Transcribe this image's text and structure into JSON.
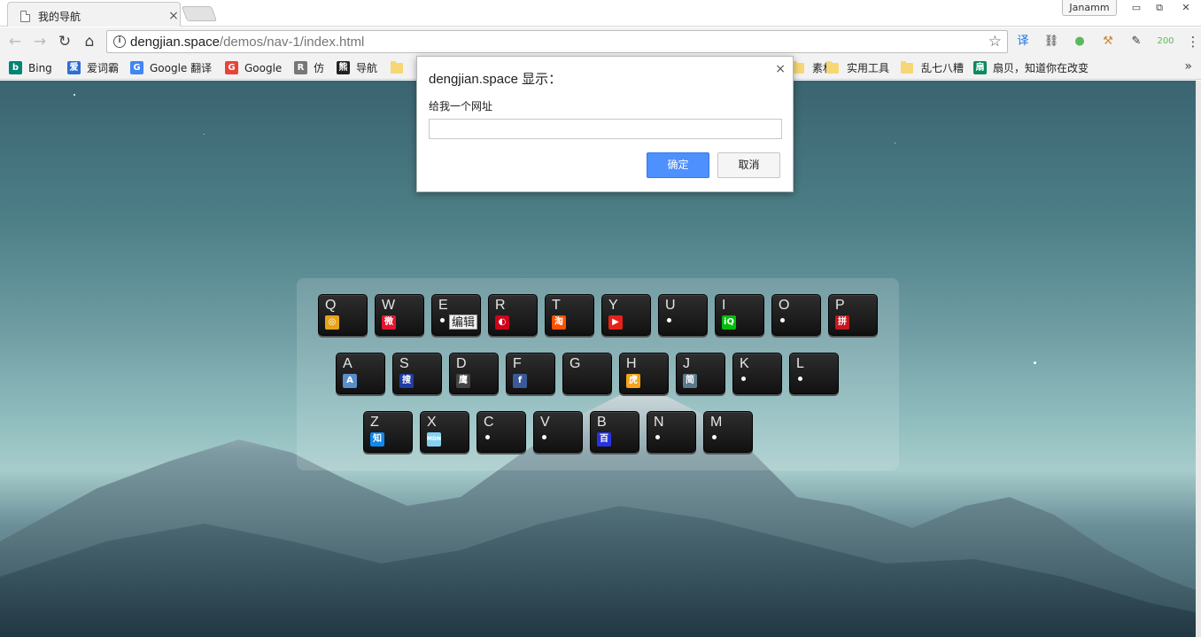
{
  "tab": {
    "title": "我的导航",
    "close": "×"
  },
  "profile": {
    "name": "Janamm"
  },
  "window": {
    "minimize": "▭",
    "restore": "⧉",
    "close": "✕"
  },
  "nav": {
    "back": "←",
    "forward": "→",
    "reload": "↻",
    "home": "⌂"
  },
  "omnibox": {
    "host": "dengjian.space",
    "path": "/demos/nav-1/index.html",
    "info": "i",
    "star": "☆"
  },
  "extensions": [
    {
      "name": "translate-icon",
      "glyph": "译",
      "color": "#1a73e8"
    },
    {
      "name": "link-extension-icon",
      "glyph": "⛓",
      "color": "#333"
    },
    {
      "name": "green-dot-icon",
      "glyph": "●",
      "color": "#5cb85c"
    },
    {
      "name": "hammer-icon",
      "glyph": "⚒",
      "color": "#c98a3c"
    },
    {
      "name": "pen-icon",
      "glyph": "✎",
      "color": "#333"
    }
  ],
  "extension_badge": "200",
  "menu_icon": "⋮",
  "bookmarks": [
    {
      "label": "Bing",
      "icon": "b",
      "color": "#008373",
      "type": "site"
    },
    {
      "label": "爱词霸",
      "icon": "爱",
      "color": "#2e6fd1",
      "type": "site"
    },
    {
      "label": "Google 翻译",
      "icon": "G",
      "color": "#4285f4",
      "type": "site"
    },
    {
      "label": "Google",
      "icon": "G",
      "color": "#ea4335",
      "type": "site"
    },
    {
      "label": "仿",
      "icon": "R",
      "color": "#777",
      "type": "site"
    },
    {
      "label": "导航",
      "icon": "熊",
      "color": "#222",
      "type": "site"
    },
    {
      "label": "",
      "type": "folder"
    },
    {
      "label": "素材",
      "type": "folder"
    },
    {
      "label": "实用工具",
      "type": "folder"
    },
    {
      "label": "乱七八糟",
      "type": "folder"
    },
    {
      "label": "扇贝，知道你在改变",
      "icon": "扇",
      "color": "#0a8a5f",
      "type": "site"
    }
  ],
  "bookmarks_more": "»",
  "dialog": {
    "title": "dengjian.space 显示：",
    "message": "给我一个网址",
    "input_value": "",
    "ok_label": "确定",
    "cancel_label": "取消",
    "close": "×"
  },
  "keyboard": {
    "rows": [
      [
        {
          "letter": "Q",
          "icon": "chrome-icon",
          "glyph": "◎",
          "color": "#e6a21a"
        },
        {
          "letter": "W",
          "icon": "weibo-icon",
          "glyph": "微",
          "color": "#e6162d"
        },
        {
          "letter": "E",
          "icon": "dot",
          "text": "编辑"
        },
        {
          "letter": "R",
          "icon": "netease-icon",
          "glyph": "◐",
          "color": "#d0021b"
        },
        {
          "letter": "T",
          "icon": "taobao-icon",
          "glyph": "淘",
          "color": "#ff5000"
        },
        {
          "letter": "Y",
          "icon": "youtube-icon",
          "glyph": "▶",
          "color": "#e62117"
        },
        {
          "letter": "U",
          "icon": "dot"
        },
        {
          "letter": "I",
          "icon": "iqiyi-icon",
          "glyph": "iQ",
          "color": "#00be06"
        },
        {
          "letter": "O",
          "icon": "dot"
        },
        {
          "letter": "P",
          "icon": "pinduoduo-icon",
          "glyph": "拼",
          "color": "#c8161d"
        }
      ],
      [
        {
          "letter": "A",
          "icon": "acfun-icon",
          "glyph": "A",
          "color": "#5a8ec9"
        },
        {
          "letter": "S",
          "icon": "sohu-icon",
          "glyph": "搜",
          "color": "#1f3da3"
        },
        {
          "letter": "D",
          "icon": "douban-icon",
          "glyph": "鹰",
          "color": "#444"
        },
        {
          "letter": "F",
          "icon": "facebook-icon",
          "glyph": "f",
          "color": "#3b5998"
        },
        {
          "letter": "G",
          "icon": "none"
        },
        {
          "letter": "H",
          "icon": "huya-icon",
          "glyph": "虎",
          "color": "#f4a51c"
        },
        {
          "letter": "J",
          "icon": "jianshu-icon",
          "glyph": "简",
          "color": "#5d7a8c"
        },
        {
          "letter": "K",
          "icon": "dot"
        },
        {
          "letter": "L",
          "icon": "dot"
        }
      ],
      [
        {
          "letter": "Z",
          "icon": "zhihu-icon",
          "glyph": "知",
          "color": "#0f88eb"
        },
        {
          "letter": "X",
          "icon": "mdn-icon",
          "glyph": "MDN",
          "color": "#83d0f2"
        },
        {
          "letter": "C",
          "icon": "dot"
        },
        {
          "letter": "V",
          "icon": "dot"
        },
        {
          "letter": "B",
          "icon": "baidu-icon",
          "glyph": "百",
          "color": "#2932e1"
        },
        {
          "letter": "N",
          "icon": "dot"
        },
        {
          "letter": "M",
          "icon": "dot"
        }
      ]
    ]
  }
}
